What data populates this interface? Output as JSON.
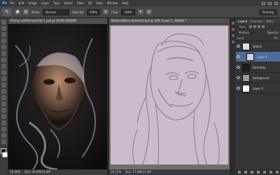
{
  "app": {
    "logo": "Ps"
  },
  "menubar": {
    "items": [
      "File",
      "Edit",
      "Image",
      "Layer",
      "Type",
      "Select",
      "Filter",
      "3D",
      "View",
      "Window",
      "Help"
    ]
  },
  "options": {
    "mode_label": "Mode:",
    "mode_value": "Normal",
    "opacity_label": "Opacity:",
    "opacity_value": "100%",
    "flow_label": "Flow:",
    "flow_value": "100%",
    "workspace": "Painting"
  },
  "doc1": {
    "tab_title": "Frenzy untitled portrait 1.psd @ 16.6% (RGB/8)",
    "zoom": "16.66%",
    "doc_size": "Doc: 49.6M/51.6M"
  },
  "doc2": {
    "tab_title": "Blubbrattbery Portrait2.psd @ 16% (Layer 1, RGB/8) *",
    "zoom": "16.12%",
    "doc_size": "Doc: 17.8M/31.3M"
  },
  "layers": {
    "tabs": [
      "Layers",
      "Channels",
      "Paths"
    ],
    "kind_label": "Kind",
    "blend_mode": "Multiply",
    "opacity_label": "Opacity:",
    "lock_label": "Lock:",
    "fill_label": "Fill:",
    "items": [
      {
        "name": "Sketch"
      },
      {
        "name": "Layer 1"
      },
      {
        "name": "Backdrop"
      },
      {
        "name": "background"
      },
      {
        "name": "Layer 0"
      }
    ]
  },
  "colors": {
    "selected_layer": "#4b6d9a",
    "canvas_tint": "#cbbcc9",
    "ui_dark": "#282828"
  }
}
